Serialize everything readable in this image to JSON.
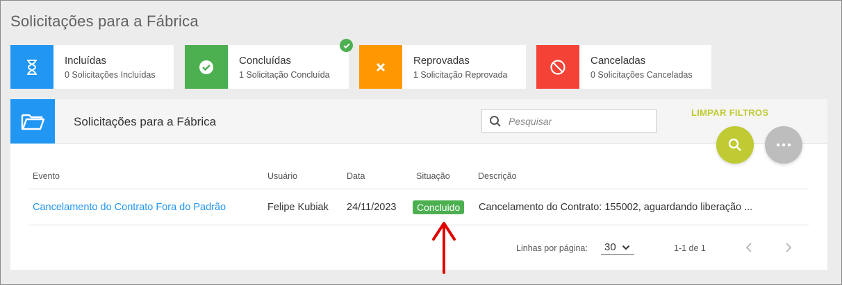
{
  "page": {
    "title": "Solicitações para a Fábrica"
  },
  "cards": [
    {
      "title": "Incluídas",
      "subtitle": "0 Solicitações Incluídas",
      "icon": "hourglass-icon",
      "color": "#2196f3"
    },
    {
      "title": "Concluídas",
      "subtitle": "1 Solicitação Concluída",
      "icon": "check-circle-icon",
      "color": "#4caf50"
    },
    {
      "title": "Reprovadas",
      "subtitle": "1 Solicitação Reprovada",
      "icon": "close-icon",
      "color": "#ff9800"
    },
    {
      "title": "Canceladas",
      "subtitle": "0 Solicitações Canceladas",
      "icon": "block-icon",
      "color": "#f44336"
    }
  ],
  "panel": {
    "title": "Solicitações para a Fábrica",
    "search_placeholder": "Pesquisar",
    "clear_filters": "LIMPAR FILTROS"
  },
  "table": {
    "headers": [
      "Evento",
      "Usuário",
      "Data",
      "Situação",
      "Descrição"
    ],
    "rows": [
      {
        "evento": "Cancelamento do Contrato Fora do Padrão",
        "usuario": "Felipe Kubiak",
        "data": "24/11/2023",
        "situacao": "Concluido",
        "descricao": "Cancelamento do Contrato: 155002, aguardando liberação ..."
      }
    ]
  },
  "pagination": {
    "rows_per_page_label": "Linhas por página:",
    "rows_per_page_value": "30",
    "range": "1-1 de 1"
  },
  "colors": {
    "accent_blue": "#2196f3",
    "success_green": "#4caf50",
    "lime": "#c0ca33",
    "annotation_red": "#e00000"
  }
}
